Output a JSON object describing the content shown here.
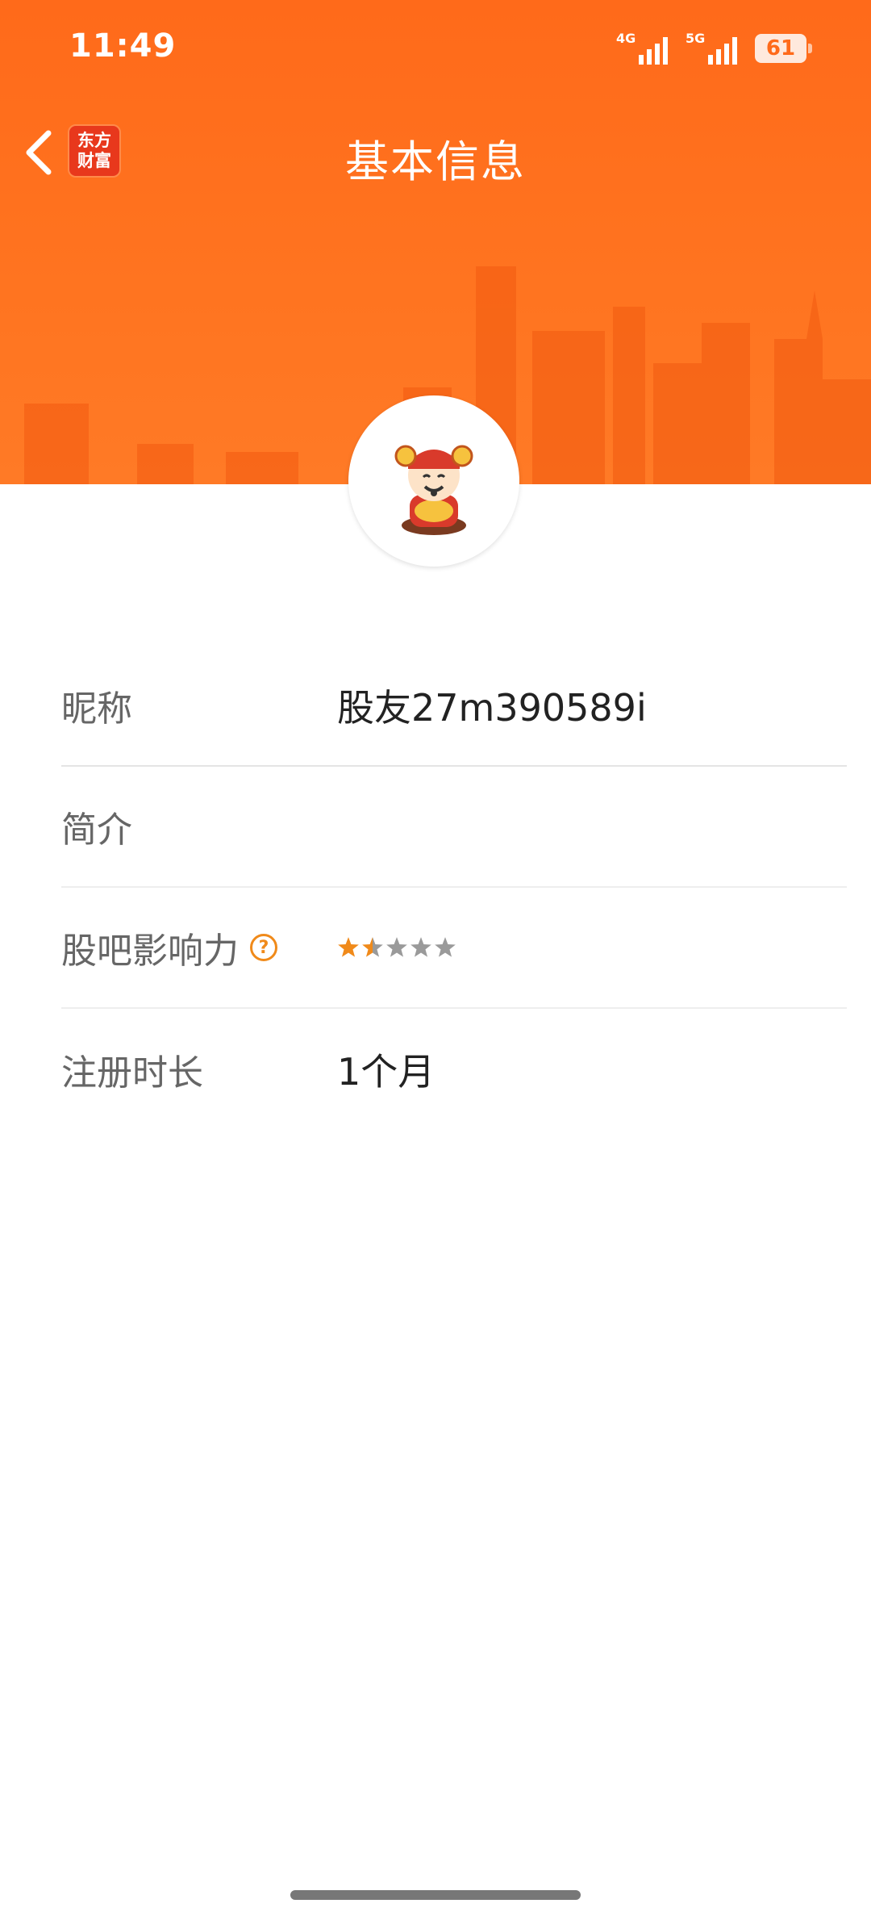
{
  "status_bar": {
    "time": "11:49",
    "network_1": "4G",
    "network_2": "5G",
    "battery": "61"
  },
  "header": {
    "title": "基本信息",
    "logo_line1": "东方",
    "logo_line2": "财富",
    "back_icon": "chevron-left-icon",
    "background_color": "#ff6a1a"
  },
  "profile": {
    "avatar_icon": "caishen-avatar",
    "rows": [
      {
        "label": "昵称",
        "value": "股友27m390589i"
      },
      {
        "label": "简介",
        "value": ""
      },
      {
        "label": "股吧影响力",
        "help_icon": "question-circle-icon",
        "rating": 1.5,
        "rating_max": 5
      },
      {
        "label": "注册时长",
        "value": "1个月"
      }
    ]
  },
  "colors": {
    "accent": "#ff6a1a",
    "star_active": "#f08a1a",
    "star_inactive": "#9a9a9a"
  }
}
